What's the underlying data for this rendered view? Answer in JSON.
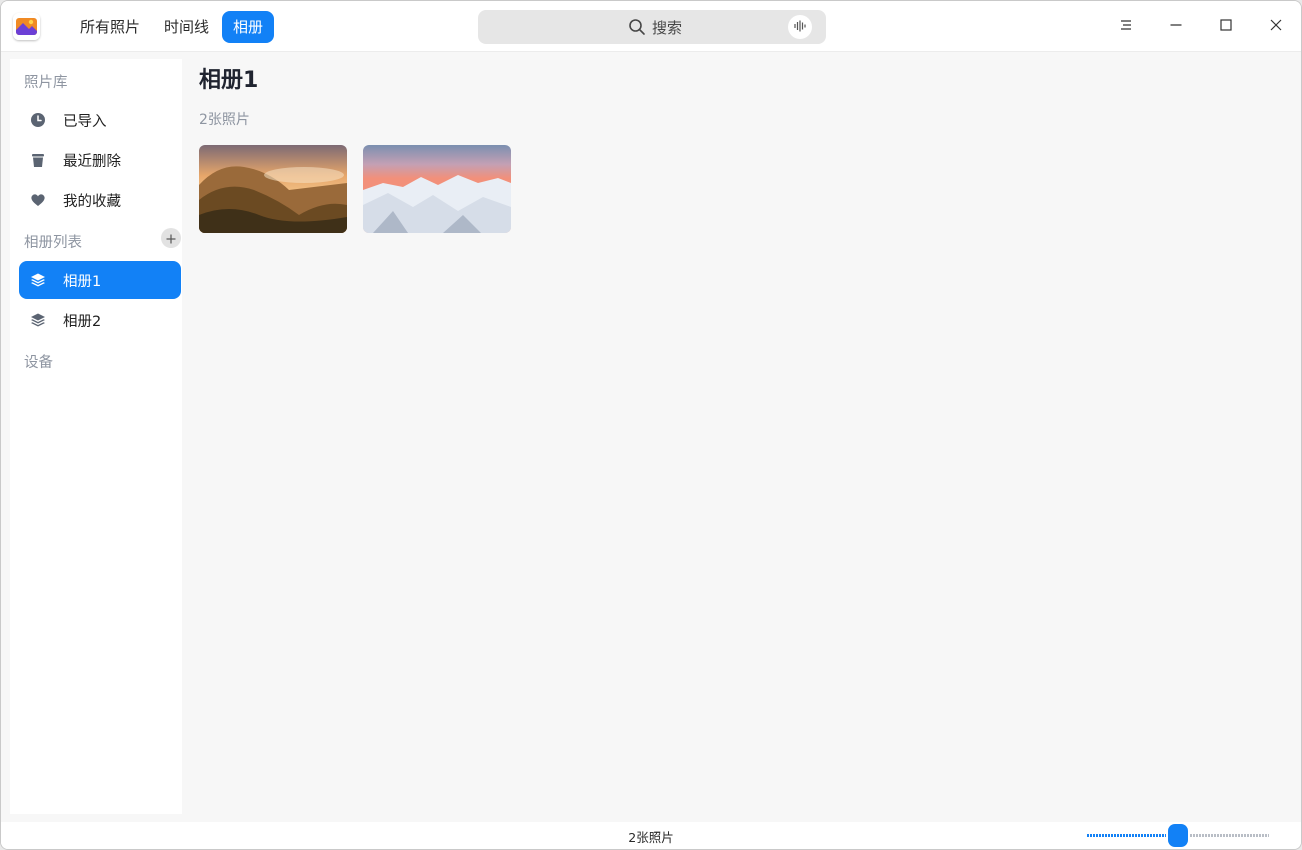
{
  "app": {
    "icon": "photo-album-app-icon"
  },
  "nav": {
    "tabs": [
      {
        "label": "所有照片",
        "active": false
      },
      {
        "label": "时间线",
        "active": false
      },
      {
        "label": "相册",
        "active": true
      }
    ]
  },
  "search": {
    "placeholder": "搜索",
    "icon": "search-icon",
    "voice_icon": "voice-input-icon"
  },
  "window_controls": [
    "menu-icon",
    "minimize-icon",
    "maximize-icon",
    "close-icon"
  ],
  "sidebar": {
    "library_header": "照片库",
    "library_items": [
      {
        "label": "已导入",
        "icon": "clock-icon"
      },
      {
        "label": "最近删除",
        "icon": "trash-icon"
      },
      {
        "label": "我的收藏",
        "icon": "heart-icon"
      }
    ],
    "albums_header": "相册列表",
    "albums": [
      {
        "label": "相册1",
        "icon": "album-stack-icon",
        "active": true
      },
      {
        "label": "相册2",
        "icon": "album-stack-icon",
        "active": false
      }
    ],
    "devices_header": "设备"
  },
  "main": {
    "title": "相册1",
    "count": "2张照片",
    "photos": [
      {
        "subject": "sunset-mountain-photo"
      },
      {
        "subject": "snowy-mountain-photo"
      }
    ]
  },
  "status": {
    "text": "2张照片",
    "zoom_fraction": 0.5
  },
  "colors": {
    "accent": "#1281f6",
    "sidebar_bg": "#ffffff",
    "content_bg": "#f7f7f7",
    "muted_text": "#8e95a1"
  }
}
